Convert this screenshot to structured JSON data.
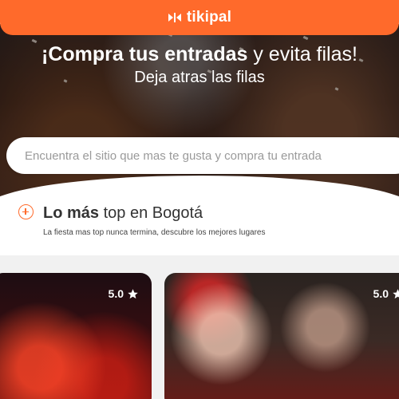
{
  "app": {
    "logo_text": "tikipal"
  },
  "hero": {
    "title_bold": "¡Compra tus entradas",
    "title_rest": " y evita filas!",
    "subtitle": "Deja atras las filas"
  },
  "search": {
    "placeholder": "Encuentra el sitio que mas te gusta y compra tu entrada"
  },
  "section": {
    "title_bold": "Lo más",
    "title_rest": " top en Bogotá",
    "description": "La fiesta mas top nunca termina, descubre los mejores lugares"
  },
  "cards": [
    {
      "rating": "5.0"
    },
    {
      "rating": "5.0"
    }
  ],
  "colors": {
    "brand": "#ff6a2b",
    "text": "#333333"
  },
  "icons": [
    "tikipal-logo-icon",
    "plus-circle-icon",
    "star-icon"
  ]
}
